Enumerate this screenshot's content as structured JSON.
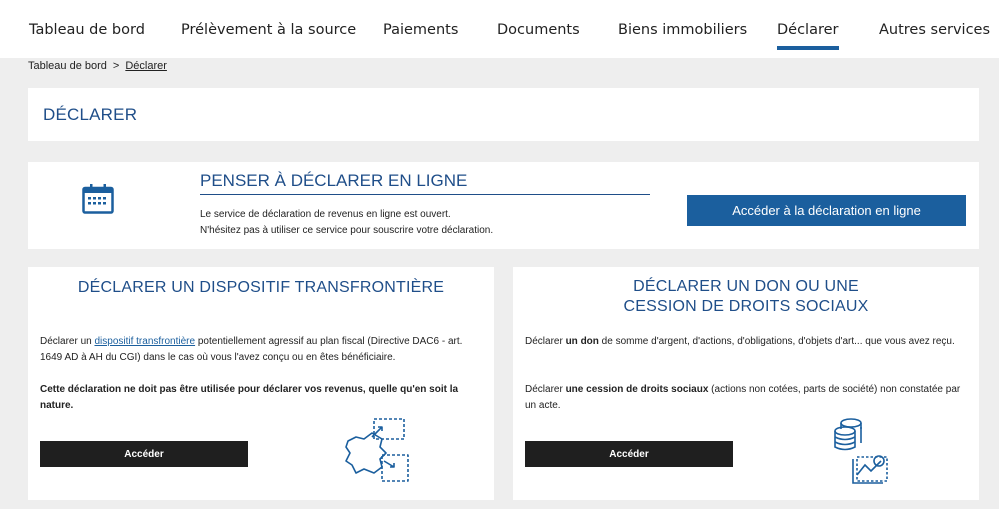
{
  "nav": {
    "items": [
      {
        "label": "Tableau de bord"
      },
      {
        "label": "Prélèvement à la source"
      },
      {
        "label": "Paiements"
      },
      {
        "label": "Documents"
      },
      {
        "label": "Biens immobiliers"
      },
      {
        "label": "Déclarer",
        "active": true
      },
      {
        "label": "Autres services"
      }
    ],
    "active_color": "#1b5f9e"
  },
  "breadcrumb": {
    "home": "Tableau de bord",
    "separator": ">",
    "current": "Déclarer"
  },
  "page": {
    "title": "DÉCLARER"
  },
  "online": {
    "icon": "calendar-icon",
    "heading": "PENSER À DÉCLARER EN LIGNE",
    "line1": "Le service de déclaration de revenus en ligne est ouvert.",
    "line2": "N'hésitez pas à utiliser ce service pour souscrire votre déclaration.",
    "button": "Accéder à la déclaration en ligne"
  },
  "transfrontiere": {
    "title": "DÉCLARER UN DISPOSITIF TRANSFRONTIÈRE",
    "text_before_link": "Déclarer un ",
    "link": "dispositif transfrontière",
    "text_after_link": " potentiellement agressif au plan fiscal (Directive DAC6 - art. 1649 AD à AH du CGI) dans le cas où vous l'avez conçu ou en êtes bénéficiaire.",
    "warning": "Cette déclaration ne doit pas être utilisée pour déclarer vos revenus, quelle qu'en soit la nature.",
    "button": "Accéder",
    "icon": "cross-border-map-icon"
  },
  "don": {
    "title_line1": "DÉCLARER UN DON OU UNE",
    "title_line2": "CESSION DE DROITS SOCIAUX",
    "p1_pre": "Déclarer ",
    "p1_bold": "un don",
    "p1_post": " de somme d'argent, d'actions, d'obligations, d'objets d'art... que vous avez reçu.",
    "p2_pre": "Déclarer ",
    "p2_bold": "une cession de droits sociaux",
    "p2_post": " (actions non cotées, parts de société) non constatée par un acte.",
    "button": "Accéder",
    "icon": "coins-chart-icon"
  },
  "colors": {
    "brand_blue": "#1f4e89",
    "button_blue": "#1b5f9e",
    "button_dark": "#1f1f1f",
    "background": "#eeeeee"
  }
}
